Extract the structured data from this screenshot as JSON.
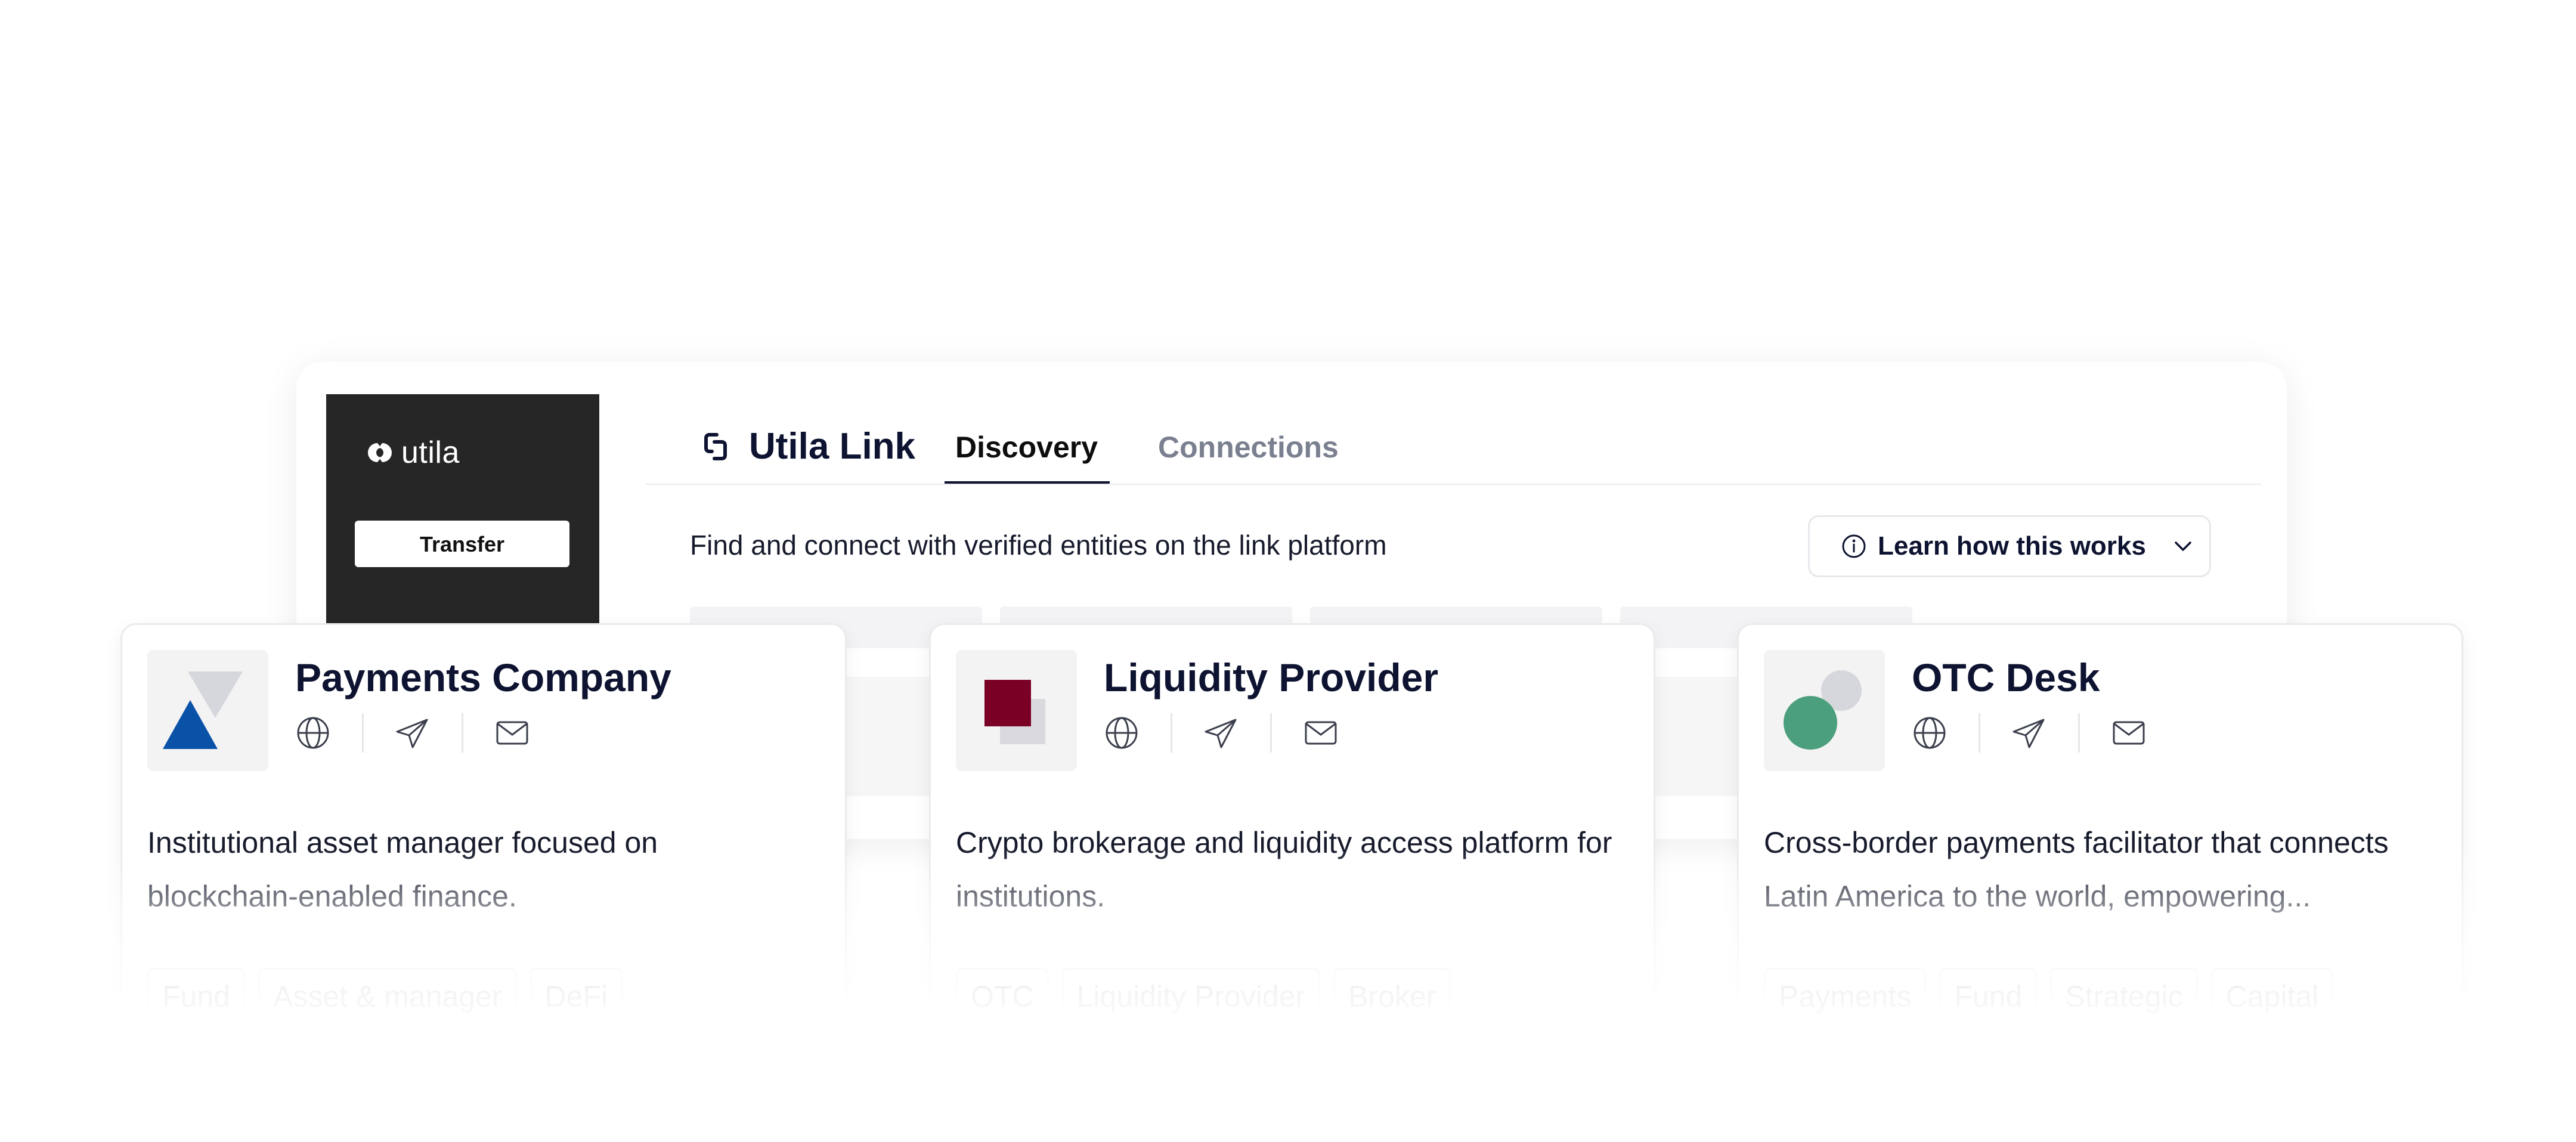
{
  "sidebar": {
    "logo_text": "utila",
    "transfer_label": "Transfer"
  },
  "header": {
    "brand_title": "Utila Link",
    "tabs": [
      {
        "label": "Discovery",
        "active": true
      },
      {
        "label": "Connections",
        "active": false
      }
    ]
  },
  "main": {
    "subtitle": "Find and connect with verified entities on the link platform",
    "learn_button_label": "Learn how this works"
  },
  "cards": [
    {
      "name": "Payments Company",
      "description": "Institutional asset manager focused on blockchain-enabled finance.",
      "tags": [
        "Fund",
        "Asset & manager",
        "DeFi"
      ],
      "logo": "triangles-logo"
    },
    {
      "name": "Liquidity Provider",
      "description": "Crypto brokerage and liquidity access platform for institutions.",
      "tags": [
        "OTC",
        "Liquidity Provider",
        "Broker"
      ],
      "logo": "squares-logo"
    },
    {
      "name": "OTC Desk",
      "description": "Cross-border payments facilitator that connects Latin America to the world, empowering...",
      "tags": [
        "Payments",
        "Fund",
        "Strategic",
        "Capital"
      ],
      "logo": "circles-logo"
    }
  ],
  "icons": {
    "website": "globe-icon",
    "telegram": "telegram-icon",
    "email": "mail-icon",
    "info": "info-icon",
    "chevron": "chevron-down-icon"
  },
  "colors": {
    "sidebar_bg": "#262626",
    "heading": "#0d1330",
    "blue_triangle": "#0a52a8",
    "maroon_square": "#7a0125",
    "green_circle": "#4c9f7c"
  }
}
